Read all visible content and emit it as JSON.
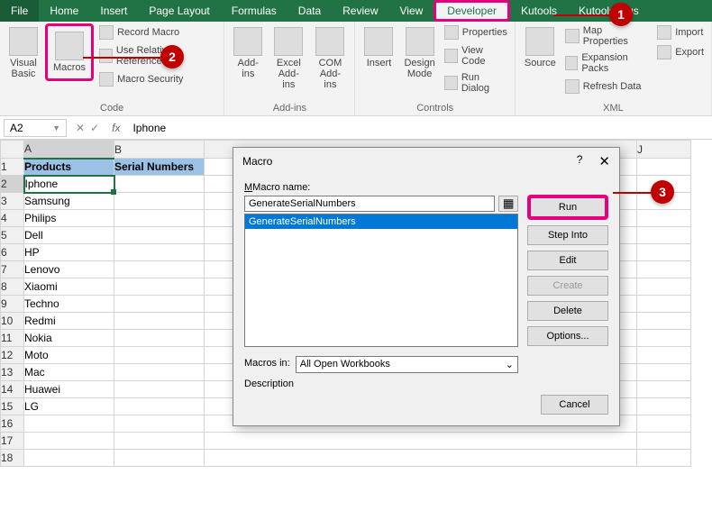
{
  "tabs": {
    "file": "File",
    "home": "Home",
    "insert": "Insert",
    "pageLayout": "Page Layout",
    "formulas": "Formulas",
    "data": "Data",
    "review": "Review",
    "view": "View",
    "developer": "Developer",
    "kutools": "Kutools",
    "kutoolsPlus": "Kutools Plus"
  },
  "ribbon": {
    "code": {
      "visualBasic": "Visual\nBasic",
      "macros": "Macros",
      "recordMacro": "Record Macro",
      "useRelative": "Use Relative References",
      "macroSecurity": "Macro Security",
      "label": "Code"
    },
    "addins": {
      "addins": "Add-\nins",
      "excelAddins": "Excel\nAdd-ins",
      "comAddins": "COM\nAdd-ins",
      "label": "Add-ins"
    },
    "controls": {
      "insert": "Insert",
      "designMode": "Design\nMode",
      "properties": "Properties",
      "viewCode": "View Code",
      "runDialog": "Run Dialog",
      "label": "Controls"
    },
    "xml": {
      "source": "Source",
      "mapProperties": "Map Properties",
      "expansionPacks": "Expansion Packs",
      "refreshData": "Refresh Data",
      "import": "Import",
      "export": "Export",
      "label": "XML"
    }
  },
  "nameBox": "A2",
  "formulaValue": "Iphone",
  "columns": [
    "A",
    "B",
    "J"
  ],
  "headers": {
    "products": "Products",
    "serial": "Serial Numbers"
  },
  "rows": [
    "Iphone",
    "Samsung",
    "Philips",
    "Dell",
    "HP",
    "Lenovo",
    "Xiaomi",
    "Techno",
    "Redmi",
    "Nokia",
    "Moto",
    "Mac",
    "Huawei",
    "LG"
  ],
  "dialog": {
    "title": "Macro",
    "nameLabel": "Macro name:",
    "nameValue": "GenerateSerialNumbers",
    "listItem": "GenerateSerialNumbers",
    "macrosInLabel": "Macros in:",
    "macrosInValue": "All Open Workbooks",
    "descriptionLabel": "Description",
    "buttons": {
      "run": "Run",
      "stepInto": "Step Into",
      "edit": "Edit",
      "create": "Create",
      "delete": "Delete",
      "options": "Options...",
      "cancel": "Cancel"
    }
  },
  "badges": {
    "b1": "1",
    "b2": "2",
    "b3": "3"
  }
}
